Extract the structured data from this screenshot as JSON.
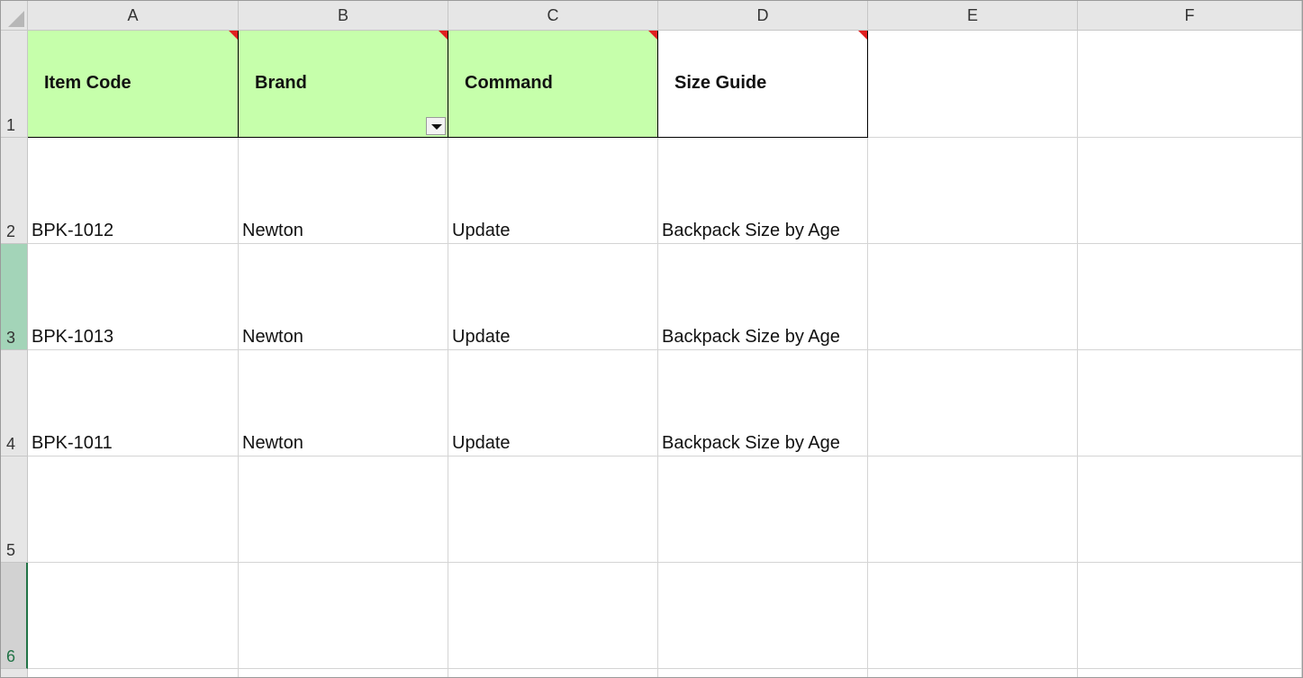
{
  "columns": [
    "A",
    "B",
    "C",
    "D",
    "E",
    "F"
  ],
  "rows": [
    "1",
    "2",
    "3",
    "4",
    "5",
    "6"
  ],
  "header_cells": {
    "a": "Item Code",
    "b": "Brand",
    "c": "Command",
    "d": "Size Guide"
  },
  "data_rows": [
    {
      "item_code": "BPK-1012",
      "brand": "Newton",
      "command": "Update",
      "size_guide": "Backpack Size by Age"
    },
    {
      "item_code": "BPK-1013",
      "brand": "Newton",
      "command": "Update",
      "size_guide": "Backpack Size by Age"
    },
    {
      "item_code": "BPK-1011",
      "brand": "Newton",
      "command": "Update",
      "size_guide": "Backpack Size by Age"
    }
  ],
  "colors": {
    "header_fill": "#c6ffab",
    "comment_indicator": "#e02020",
    "selection_accent": "#217346"
  },
  "icons": {
    "dropdown": "chevron-down-icon",
    "comment": "comment-indicator-icon",
    "select_all": "select-all-icon"
  }
}
